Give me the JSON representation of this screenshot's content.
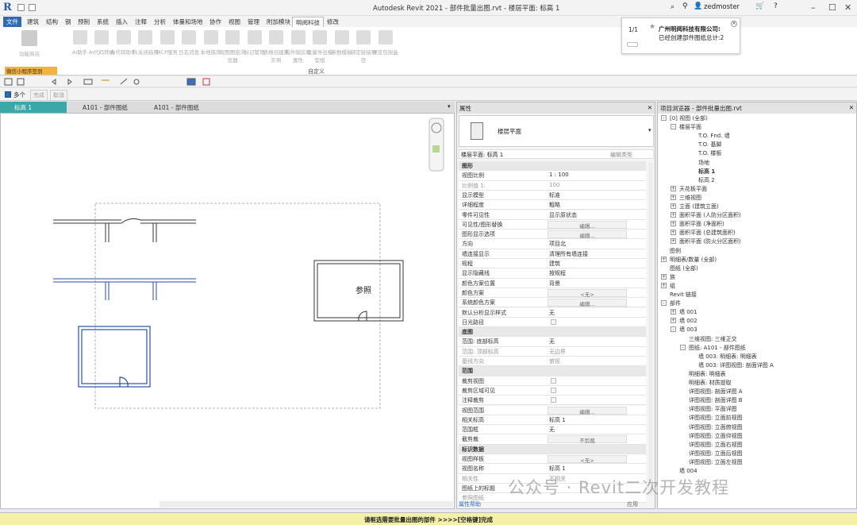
{
  "window": {
    "title": "Autodesk Revit 2021 - 部件批量出图.rvt - 楼层平面: 标高 1",
    "user": "zedmoster"
  },
  "ribbon_tabs": [
    "文件",
    "建筑",
    "结构",
    "钢",
    "预制",
    "系统",
    "插入",
    "注释",
    "分析",
    "体量和场地",
    "协作",
    "视图",
    "管理",
    "附加模块",
    "明阅科技",
    "修改"
  ],
  "ribbon_tools": [
    "功能商店",
    "AI助手",
    "AI代码转换",
    "AI代码助手",
    "F1关闭启用",
    "MCP服务",
    "日志消息",
    "本地族库",
    "视图图纸浏览器",
    "标记管理",
    "表格创建族实例",
    "构件赋房间属性",
    "批量导出模型组",
    "参数模板",
    "绑定链接项目",
    "预览包围盒"
  ],
  "ribbon_panel": {
    "wx": "微信小程序签到",
    "custom": "自定义"
  },
  "optbar": {
    "multi": "多个",
    "finish": "完成",
    "cancel": "取消"
  },
  "view_tabs": [
    "标高 1",
    "A101 - 部件图纸",
    "A101 - 部件图纸"
  ],
  "canvas": {
    "ref_label": "参照"
  },
  "notification": {
    "page": "1/1",
    "company": "广州明阅科技有限公司:",
    "message": "已经创建部件图纸总计:2"
  },
  "properties": {
    "header": "属性",
    "type_name": "楼层平面",
    "instance": "楼层平面: 标高 1",
    "edit_type": "编辑类型",
    "help": "属性帮助",
    "apply": "应用",
    "rows": [
      {
        "k": "图形",
        "g": true
      },
      {
        "k": "视图比例",
        "v": "1 : 100"
      },
      {
        "k": "比例值 1:",
        "v": "100",
        "grey": true
      },
      {
        "k": "显示模型",
        "v": "标准"
      },
      {
        "k": "详细程度",
        "v": "粗略"
      },
      {
        "k": "零件可见性",
        "v": "显示原状态"
      },
      {
        "k": "可见性/图形替换",
        "b": "编辑..."
      },
      {
        "k": "图形显示选项",
        "b": "编辑..."
      },
      {
        "k": "方向",
        "v": "项目北"
      },
      {
        "k": "墙连接显示",
        "v": "清理所有墙连接"
      },
      {
        "k": "规程",
        "v": "建筑"
      },
      {
        "k": "显示隐藏线",
        "v": "按规程"
      },
      {
        "k": "颜色方案位置",
        "v": "背景"
      },
      {
        "k": "颜色方案",
        "b": "<无>"
      },
      {
        "k": "系统颜色方案",
        "b": "编辑..."
      },
      {
        "k": "默认分析显示样式",
        "v": "无"
      },
      {
        "k": "日光路径",
        "c": true
      },
      {
        "k": "底图",
        "g": true
      },
      {
        "k": "范围: 底部标高",
        "v": "无"
      },
      {
        "k": "范围: 顶部标高",
        "v": "无边界",
        "grey": true
      },
      {
        "k": "基线方向",
        "v": "俯视",
        "grey": true
      },
      {
        "k": "范围",
        "g": true
      },
      {
        "k": "裁剪视图",
        "c": true
      },
      {
        "k": "裁剪区域可见",
        "c": true
      },
      {
        "k": "注释裁剪",
        "c": true
      },
      {
        "k": "视图范围",
        "b": "编辑..."
      },
      {
        "k": "相关标高",
        "v": "标高 1"
      },
      {
        "k": "范围框",
        "v": "无"
      },
      {
        "k": "截剪裁",
        "b": "不剪裁"
      },
      {
        "k": "标识数据",
        "g": true
      },
      {
        "k": "视图样板",
        "b": "<无>"
      },
      {
        "k": "视图名称",
        "v": "标高 1"
      },
      {
        "k": "相关性",
        "v": "不相关",
        "grey": true
      },
      {
        "k": "图纸上的标题",
        "v": ""
      },
      {
        "k": "参照图纸",
        "v": "",
        "grey": true
      }
    ]
  },
  "browser": {
    "header": "项目浏览器 - 部件批量出图.rvt",
    "nodes": [
      {
        "t": "[0] 视图 (全部)",
        "l": 0,
        "e": "-"
      },
      {
        "t": "楼层平面",
        "l": 1,
        "e": "-"
      },
      {
        "t": "T.O. Fnd. 墙",
        "l": 3
      },
      {
        "t": "T.O. 基脚",
        "l": 3
      },
      {
        "t": "T.O. 楼板",
        "l": 3
      },
      {
        "t": "场地",
        "l": 3
      },
      {
        "t": "标高 1",
        "l": 3,
        "b": true
      },
      {
        "t": "标高 2",
        "l": 3
      },
      {
        "t": "天花板平面",
        "l": 1,
        "e": "+"
      },
      {
        "t": "三维视图",
        "l": 1,
        "e": "+"
      },
      {
        "t": "立面 (建筑立面)",
        "l": 1,
        "e": "+"
      },
      {
        "t": "面积平面 (人防分区面积)",
        "l": 1,
        "e": "+"
      },
      {
        "t": "面积平面 (净面积)",
        "l": 1,
        "e": "+"
      },
      {
        "t": "面积平面 (总建筑面积)",
        "l": 1,
        "e": "+"
      },
      {
        "t": "面积平面 (防火分区面积)",
        "l": 1,
        "e": "+"
      },
      {
        "t": "图例",
        "l": 0
      },
      {
        "t": "明细表/数量 (全部)",
        "l": 0,
        "e": "+"
      },
      {
        "t": "图纸 (全部)",
        "l": 0
      },
      {
        "t": "族",
        "l": 0,
        "e": "+"
      },
      {
        "t": "组",
        "l": 0,
        "e": "+"
      },
      {
        "t": "Revit 链接",
        "l": 0
      },
      {
        "t": "部件",
        "l": 0,
        "e": "-"
      },
      {
        "t": "墙 001",
        "l": 1,
        "e": "+"
      },
      {
        "t": "墙 002",
        "l": 1,
        "e": "+"
      },
      {
        "t": "墙 003",
        "l": 1,
        "e": "-"
      },
      {
        "t": "三维视图: 三维正交",
        "l": 2
      },
      {
        "t": "图纸: A101 - 部件图纸",
        "l": 2,
        "e": "-"
      },
      {
        "t": "墙 003: 明细表: 明细表",
        "l": 3
      },
      {
        "t": "墙 003: 详图视图: 剖面详图 A",
        "l": 3
      },
      {
        "t": "明细表: 明细表",
        "l": 2
      },
      {
        "t": "明细表: 材质提取",
        "l": 2
      },
      {
        "t": "详图视图: 剖面详图 A",
        "l": 2
      },
      {
        "t": "详图视图: 剖面详图 B",
        "l": 2
      },
      {
        "t": "详图视图: 平面详图",
        "l": 2
      },
      {
        "t": "详图视图: 立面前视图",
        "l": 2
      },
      {
        "t": "详图视图: 立面俯视图",
        "l": 2
      },
      {
        "t": "详图视图: 立面仰视图",
        "l": 2
      },
      {
        "t": "详图视图: 立面右视图",
        "l": 2
      },
      {
        "t": "详图视图: 立面后视图",
        "l": 2
      },
      {
        "t": "详图视图: 立面左视图",
        "l": 2
      },
      {
        "t": "墙 004",
        "l": 1
      }
    ]
  },
  "status": "请框选需要批量出图的部件 >>>>[空格键]完成",
  "watermark": "公众号 · Revit二次开发教程",
  "colors": {
    "file_tab": "#2d6bb5",
    "active_view_tab": "#3aa8a8",
    "status_bg": "#f4f0a8",
    "wall_blue": "#2a4fa8"
  }
}
